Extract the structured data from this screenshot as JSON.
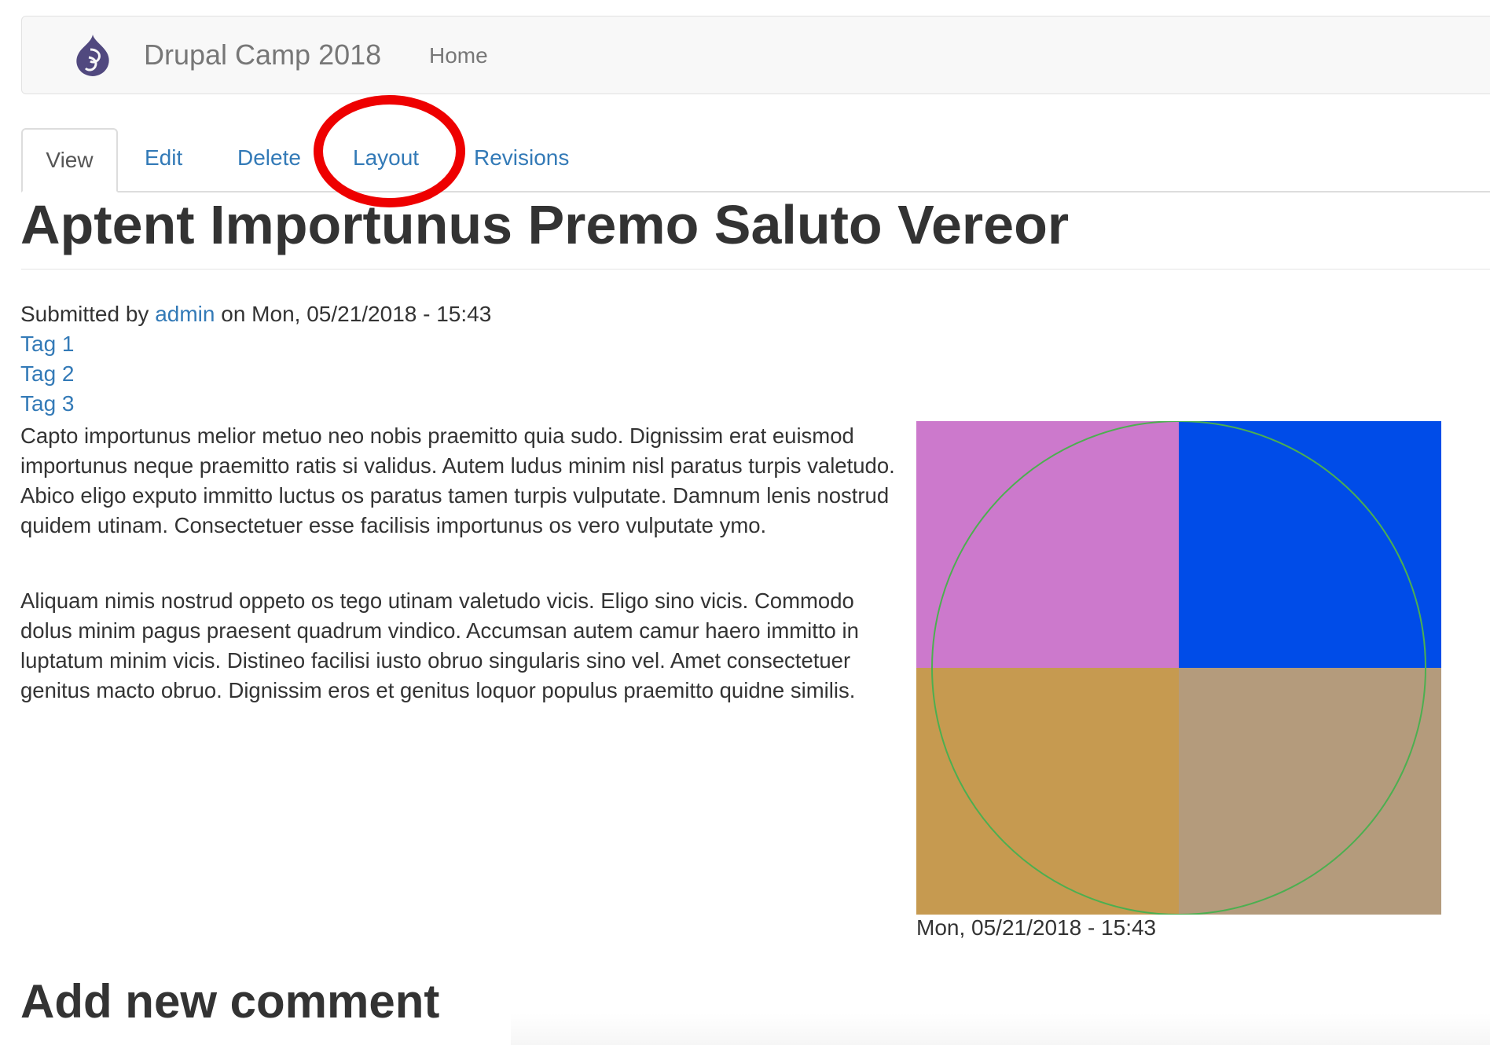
{
  "navbar": {
    "site_name": "Drupal Camp 2018",
    "links": [
      {
        "label": "Home"
      }
    ],
    "logo_icon": "drupal-drop-icon"
  },
  "tabs": [
    {
      "label": "View",
      "active": true
    },
    {
      "label": "Edit",
      "active": false
    },
    {
      "label": "Delete",
      "active": false
    },
    {
      "label": "Layout",
      "active": false,
      "highlighted": true
    },
    {
      "label": "Revisions",
      "active": false
    }
  ],
  "article": {
    "title": "Aptent Importunus Premo Saluto Vereor",
    "submitted_prefix": "Submitted by",
    "author": "admin",
    "submitted_suffix": "on Mon, 05/21/2018 - 15:43",
    "tags": [
      "Tag 1",
      "Tag 2",
      "Tag 3"
    ],
    "paragraphs": [
      "Capto importunus melior metuo neo nobis praemitto quia sudo. Dignissim erat euismod importunus neque praemitto ratis si validus. Autem ludus minim nisl paratus turpis valetudo. Abico eligo exputo immitto luctus os paratus tamen turpis vulputate. Damnum lenis nostrud quidem utinam. Consectetuer esse facilisis importunus os vero vulputate ymo.",
      "Aliquam nimis nostrud oppeto os tego utinam valetudo vicis. Eligo sino vicis. Commodo dolus minim pagus praesent quadrum vindico. Accumsan autem camur haero immitto in luptatum minim vicis. Distineo facilisi iusto obruo singularis sino vel. Amet consectetuer genitus macto obruo. Dignissim eros et genitus loquor populus praemitto quidne similis."
    ],
    "image_date": "Mon, 05/21/2018 - 15:43",
    "image_colors": {
      "top_left": "#cc79cc",
      "top_right": "#004ce8",
      "bottom_left": "#c69a50",
      "bottom_right": "#b49b7c",
      "circle": "#4caf50"
    }
  },
  "comments": {
    "heading": "Add new comment"
  },
  "colors": {
    "link": "#337ab7",
    "highlight": "#ee0000"
  }
}
